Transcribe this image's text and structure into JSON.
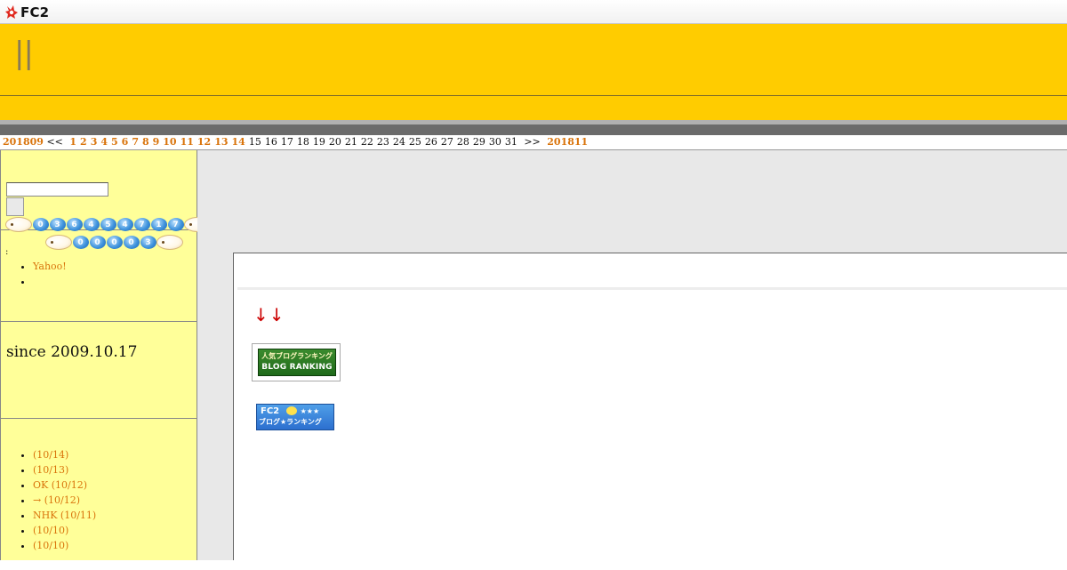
{
  "fc2_bar": {
    "logo_text": "FC2"
  },
  "header": {
    "title": "||"
  },
  "calendar": {
    "prev_month": "201809",
    "prev_nav": "<<",
    "next_nav": ">>",
    "next_month": "201811",
    "days": [
      {
        "day": "1",
        "link": true
      },
      {
        "day": "2",
        "link": true
      },
      {
        "day": "3",
        "link": true
      },
      {
        "day": "4",
        "link": true
      },
      {
        "day": "5",
        "link": true
      },
      {
        "day": "6",
        "link": true
      },
      {
        "day": "7",
        "link": true
      },
      {
        "day": "8",
        "link": true
      },
      {
        "day": "9",
        "link": true
      },
      {
        "day": "10",
        "link": true
      },
      {
        "day": "11",
        "link": true
      },
      {
        "day": "12",
        "link": true
      },
      {
        "day": "13",
        "link": true
      },
      {
        "day": "14",
        "link": true
      },
      {
        "day": "15",
        "link": false
      },
      {
        "day": "16",
        "link": false
      },
      {
        "day": "17",
        "link": false
      },
      {
        "day": "18",
        "link": false
      },
      {
        "day": "19",
        "link": false
      },
      {
        "day": "20",
        "link": false
      },
      {
        "day": "21",
        "link": false
      },
      {
        "day": "22",
        "link": false
      },
      {
        "day": "23",
        "link": false
      },
      {
        "day": "24",
        "link": false
      },
      {
        "day": "25",
        "link": false
      },
      {
        "day": "26",
        "link": false
      },
      {
        "day": "27",
        "link": false
      },
      {
        "day": "28",
        "link": false
      },
      {
        "day": "29",
        "link": false
      },
      {
        "day": "30",
        "link": false
      },
      {
        "day": "31",
        "link": false
      }
    ]
  },
  "sidebar": {
    "search": {
      "input_value": "",
      "button_label": ""
    },
    "links": [
      {
        "label": "Yahoo!"
      },
      {
        "label": ""
      }
    ],
    "counter": {
      "since": "since 2009.10.17",
      "total_digits": [
        "0",
        "3",
        "6",
        "4",
        "5",
        "4",
        "7",
        "1",
        "7"
      ],
      "today_digits": [
        "0",
        "0",
        "0",
        "0",
        "3"
      ],
      "colon": ":"
    },
    "recent_entries": [
      {
        "label": " (10/14)"
      },
      {
        "label": " (10/13)"
      },
      {
        "label": "OK (10/12)"
      },
      {
        "label": "→ (10/12)"
      },
      {
        "label": "NHK (10/11)"
      },
      {
        "label": " (10/10)"
      },
      {
        "label": " (10/10)"
      }
    ]
  },
  "main": {
    "arrows": "↓↓",
    "banner_ranking": {
      "line1": "人気ブログランキング",
      "line2": "BLOG RANKING"
    },
    "banner_fc2": {
      "line1": "FC2",
      "stars": "★★★",
      "line2": "ブログ★ランキング"
    }
  },
  "colors": {
    "header_yellow": "#ffcc00",
    "sidebar_yellow": "#ffff99",
    "link_orange": "#d9740c",
    "arrow_red": "#cc0000"
  }
}
